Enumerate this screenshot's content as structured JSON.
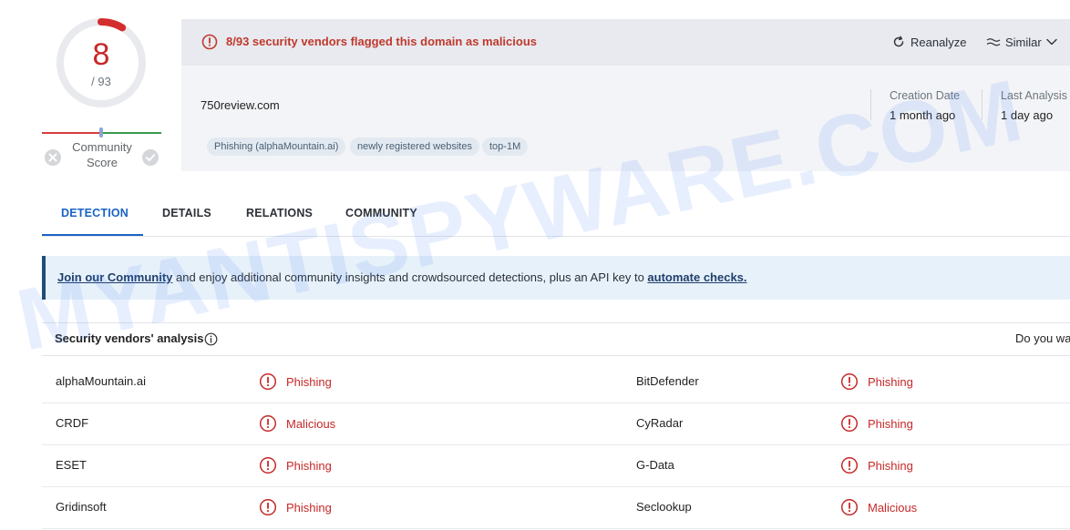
{
  "score": {
    "detections": "8",
    "total": "/ 93",
    "detection_fraction": 0.086
  },
  "community": {
    "label_line1": "Community",
    "label_line2": "Score"
  },
  "alert": {
    "text": "8/93 security vendors flagged this domain as malicious"
  },
  "actions": {
    "reanalyze": "Reanalyze",
    "similar": "Similar"
  },
  "domain": {
    "name": "750review.com"
  },
  "tags": [
    "Phishing (alphaMountain.ai)",
    "newly registered websites",
    "top-1M"
  ],
  "meta": {
    "creation_label": "Creation Date",
    "creation_value": "1 month ago",
    "last_analysis_label": "Last Analysis",
    "last_analysis_value": "1 day ago"
  },
  "tabs": [
    "DETECTION",
    "DETAILS",
    "RELATIONS",
    "COMMUNITY"
  ],
  "banner": {
    "link1": "Join our Community",
    "middle": " and enjoy additional community insights and crowdsourced detections, plus an API key to ",
    "link2": "automate checks."
  },
  "vendors": {
    "title": "Security vendors' analysis",
    "prompt": "Do you wa",
    "rows": [
      {
        "left_vendor": "alphaMountain.ai",
        "left_verdict": "Phishing",
        "right_vendor": "BitDefender",
        "right_verdict": "Phishing"
      },
      {
        "left_vendor": "CRDF",
        "left_verdict": "Malicious",
        "right_vendor": "CyRadar",
        "right_verdict": "Phishing"
      },
      {
        "left_vendor": "ESET",
        "left_verdict": "Phishing",
        "right_vendor": "G-Data",
        "right_verdict": "Phishing"
      },
      {
        "left_vendor": "Gridinsoft",
        "left_verdict": "Phishing",
        "right_vendor": "Seclookup",
        "right_verdict": "Malicious"
      }
    ]
  },
  "watermark": "MYANTISPYWARE.COM",
  "colors": {
    "danger": "#c62828",
    "accent": "#1a63c5",
    "banner_bg": "#e7f1fa",
    "alert_bg": "#e8eaf0"
  }
}
